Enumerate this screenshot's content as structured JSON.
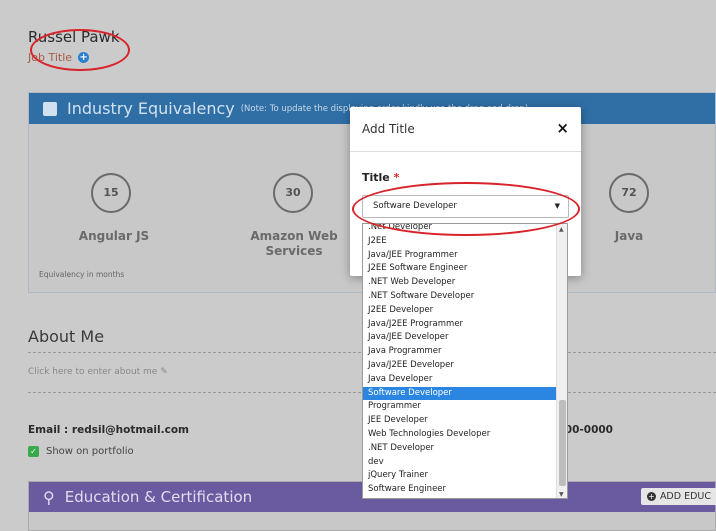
{
  "profile": {
    "name": "Russel Pawk",
    "job_title": "Job Title"
  },
  "industry": {
    "title": "Industry Equivalency",
    "note": "(Note: To update the displaying order kindly use the drag and drop)",
    "skills": [
      {
        "months": "15",
        "label": "Angular JS"
      },
      {
        "months": "30",
        "label": "Amazon Web Services"
      },
      {
        "months": "72",
        "label": "Java"
      }
    ],
    "footer": "Equivalency in months"
  },
  "about": {
    "heading": "About Me",
    "hint": "Click here to enter about me"
  },
  "contact": {
    "email": "Email : redsil@hotmail.com",
    "phone": ")00-0000",
    "show_portfolio": "Show on portfolio"
  },
  "education": {
    "title": "Education & Certification",
    "add_button": "ADD EDUC"
  },
  "modal": {
    "title": "Add Title",
    "close": "×",
    "field_label": "Title",
    "required": "*",
    "selected": "Software Developer"
  },
  "dropdown_options": [
    ".Net Developer",
    "J2EE",
    "Java/JEE Programmer",
    "J2EE Software Engineer",
    ".NET Web Developer",
    ".NET Software Developer",
    "J2EE Developer",
    "Java/J2EE Programmer",
    "Java/JEE Developer",
    "Java Programmer",
    "Java/J2EE Developer",
    "Java Developer",
    "Software Developer",
    "Programmer",
    "JEE Developer",
    "Web Technologies Developer",
    ".NET Developer",
    "dev",
    "jQuery Trainer",
    "Software Engineer"
  ],
  "colors": {
    "industry_header": "#2f6fa6",
    "education_header": "#6a5aa0",
    "highlight": "#2a86e0",
    "annotation": "#d8232a"
  }
}
